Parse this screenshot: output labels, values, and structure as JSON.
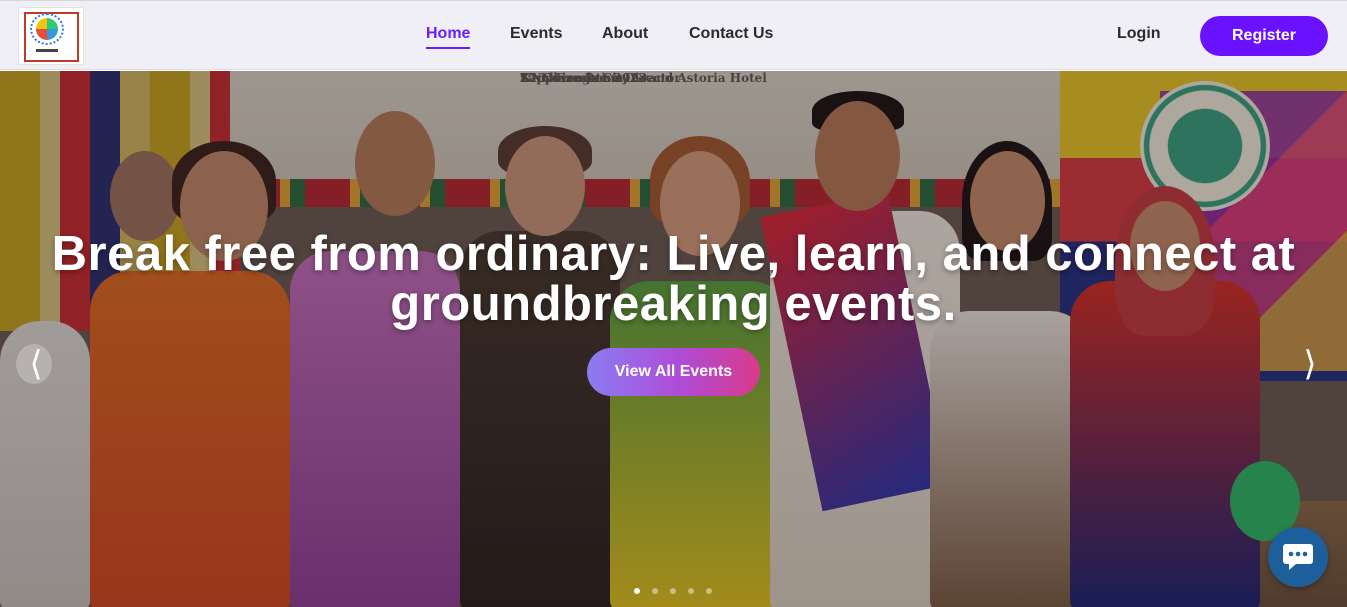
{
  "navbar": {
    "logo_alt": "logo",
    "links": [
      {
        "label": "Home",
        "active": true
      },
      {
        "label": "Events",
        "active": false
      },
      {
        "label": "About",
        "active": false
      },
      {
        "label": "Contact Us",
        "active": false
      }
    ],
    "login_label": "Login",
    "register_label": "Register"
  },
  "hero": {
    "banner_lines": [
      "NNC Executive Director",
      "17 November 2023",
      "Sapphire Room, Grand Astoria Hotel",
      "Zamboanga City"
    ],
    "title": "Break free from ordinary: Live, learn, and connect at groundbreaking events.",
    "cta_label": "View All Events",
    "prev_icon": "chevron-left-icon",
    "next_icon": "chevron-right-icon",
    "slides_total": 5,
    "active_slide": 1
  },
  "chat": {
    "icon": "chat-bubble-icon"
  },
  "colors": {
    "accent": "#6a12ff",
    "nav_bg": "#f0eff5",
    "cta_gradient_start": "#8a7cf2",
    "cta_gradient_end": "#d93a8a",
    "chat_bg": "#1d5f9a"
  }
}
